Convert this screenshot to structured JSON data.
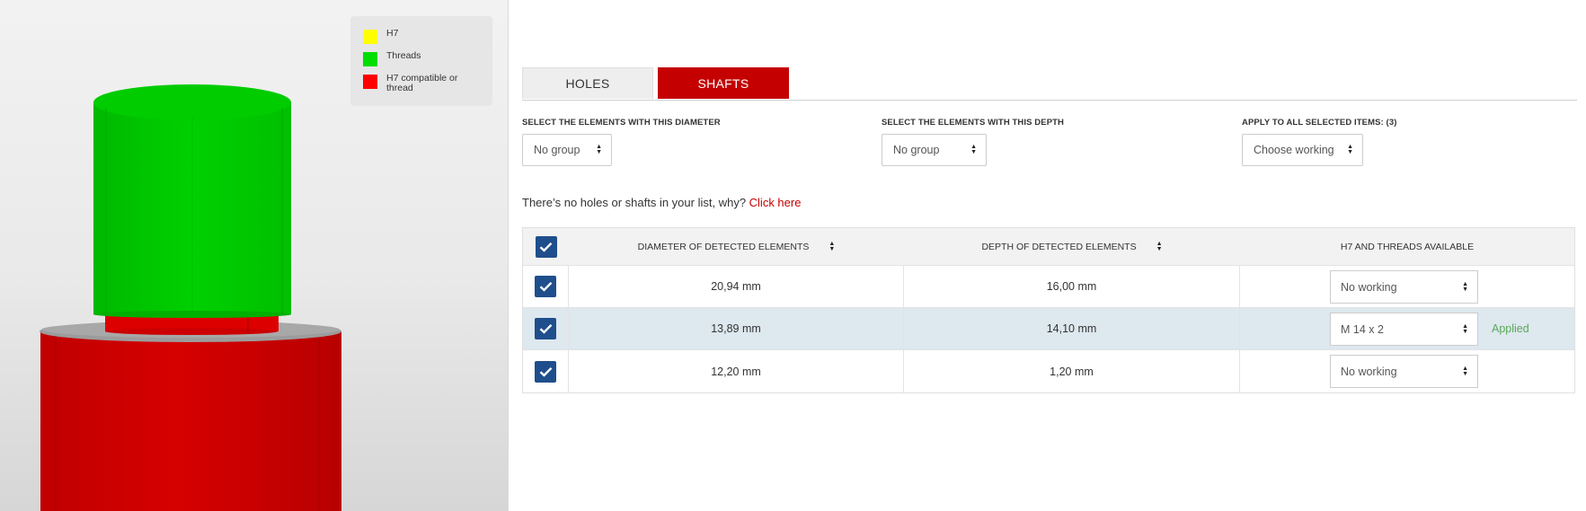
{
  "legend": {
    "items": [
      {
        "label": "H7",
        "color": "#ffff00"
      },
      {
        "label": "Threads",
        "color": "#00dd00"
      },
      {
        "label": "H7 compatible or thread",
        "color": "#ff0000"
      }
    ]
  },
  "model": {
    "colors": {
      "top_cylinder": "#00cc00",
      "neck": "#dd0000",
      "base_cylinder": "#cc0000",
      "shoulder": "#9a9a9a"
    }
  },
  "tabs": {
    "holes": "HOLES",
    "shafts": "SHAFTS",
    "active": "SHAFTS",
    "active_color": "#c40000"
  },
  "filters": {
    "diameter": {
      "label": "SELECT THE ELEMENTS WITH THIS DIAMETER",
      "value": "No group"
    },
    "depth": {
      "label": "SELECT THE ELEMENTS WITH THIS DEPTH",
      "value": "No group"
    },
    "apply": {
      "label": "APPLY TO ALL SELECTED ITEMS: (3)",
      "value": "Choose working"
    }
  },
  "notice": {
    "text": "There’s no holes or shafts in your list, why? ",
    "link": "Click here"
  },
  "table": {
    "headers": {
      "diameter": "DIAMETER OF DETECTED ELEMENTS",
      "depth": "DEPTH OF DETECTED ELEMENTS",
      "working": "H7 AND THREADS AVAILABLE"
    },
    "rows": [
      {
        "checked": true,
        "diameter": "20,94 mm",
        "depth": "16,00 mm",
        "working": "No working",
        "status": ""
      },
      {
        "checked": true,
        "diameter": "13,89 mm",
        "depth": "14,10 mm",
        "working": "M 14 x 2",
        "status": "Applied"
      },
      {
        "checked": true,
        "diameter": "12,20 mm",
        "depth": "1,20 mm",
        "working": "No working",
        "status": ""
      }
    ]
  }
}
